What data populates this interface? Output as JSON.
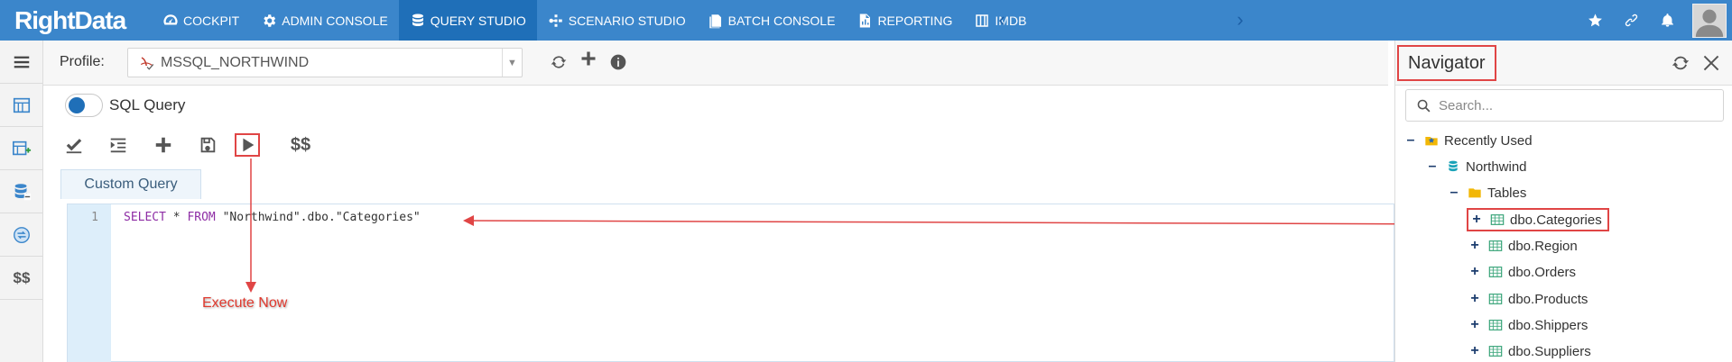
{
  "app": {
    "logo_text": "RightData",
    "nav": [
      {
        "label": "COCKPIT",
        "icon": "gauge-icon"
      },
      {
        "label": "ADMIN CONSOLE",
        "icon": "gear-icon"
      },
      {
        "label": "QUERY STUDIO",
        "icon": "database-icon",
        "active": true
      },
      {
        "label": "SCENARIO STUDIO",
        "icon": "scenario-icon"
      },
      {
        "label": "BATCH CONSOLE",
        "icon": "batch-icon"
      },
      {
        "label": "REPORTING",
        "icon": "report-icon"
      },
      {
        "label": "IMDB",
        "icon": "columns-icon"
      }
    ],
    "top_icons": [
      "star-icon",
      "link-icon",
      "bell-icon",
      "avatar"
    ]
  },
  "sidebar": {
    "items": [
      "menu-icon",
      "catalog-icon",
      "table-add-icon",
      "database-stack-icon",
      "compare-icon"
    ],
    "dollar_label": "$$"
  },
  "profile": {
    "label": "Profile:",
    "value": "MSSQL_NORTHWIND"
  },
  "editor": {
    "toggle_label": "SQL Query",
    "dollar_label": "$$",
    "tab_label": "Custom Query",
    "line_number": "1",
    "code_kw1": "SELECT",
    "code_star": " * ",
    "code_kw2": "FROM",
    "code_rest": " \"Northwind\".dbo.\"Categories\""
  },
  "annotation": {
    "execute_label": "Execute Now",
    "color": "#e04545"
  },
  "navigator": {
    "title": "Navigator",
    "search_placeholder": "Search...",
    "recently_used": "Recently Used",
    "database": "Northwind",
    "folder": "Tables",
    "tables": [
      "dbo.Categories",
      "dbo.Region",
      "dbo.Orders",
      "dbo.Products",
      "dbo.Shippers",
      "dbo.Suppliers"
    ]
  },
  "colors": {
    "topbar": "#3b86cb",
    "topbar_active": "#1f6fb8",
    "keyword": "#8e2da5",
    "highlight": "#e04545"
  }
}
